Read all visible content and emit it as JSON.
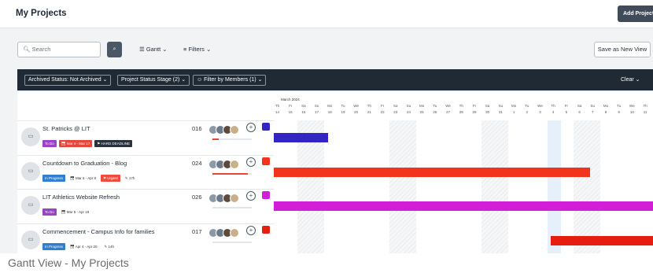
{
  "header": {
    "title": "My Projects",
    "add_button": "Add Project"
  },
  "toolbar": {
    "search_placeholder": "Search",
    "view_select": "Gantt",
    "filters_label": "Filters",
    "save_view": "Save as New View"
  },
  "filterbar": {
    "chips": [
      "Archived Status: Not Archived",
      "Project Status Stage (2)",
      "Filter by Members (1)"
    ],
    "clear": "Clear"
  },
  "timeline": {
    "month": "March 2024",
    "weekdays": [
      "Th",
      "Fr",
      "Sa",
      "Su",
      "Mo",
      "Tu",
      "We",
      "Th",
      "Fr",
      "Sa",
      "Su",
      "Mo",
      "Tu",
      "We",
      "Th",
      "Fr",
      "Sa",
      "Su",
      "Mo",
      "Tu",
      "We",
      "Th",
      "Fr",
      "Sa",
      "Su",
      "Mo",
      "Tu",
      "We",
      "Th"
    ],
    "dates": [
      "14",
      "15",
      "16",
      "17",
      "18",
      "19",
      "20",
      "21",
      "22",
      "23",
      "24",
      "25",
      "26",
      "27",
      "28",
      "29",
      "30",
      "31",
      "1",
      "2",
      "3",
      "4",
      "5",
      "6",
      "7",
      "8",
      "9",
      "10",
      "11"
    ]
  },
  "projects": [
    {
      "name": "St. Patricks @ LIT",
      "id": "016",
      "status": "To Do",
      "date": "Mar 4 - Mar 17",
      "flag": "HARD DEADLINE",
      "avatar_icon": "folder-icon",
      "bar_color": "#3324c4",
      "progress": 0.15
    },
    {
      "name": "Countdown to Graduation - Blog",
      "id": "024",
      "status": "In Progress",
      "date": "Mar 5 - Apr 8",
      "flag": "Urgent",
      "hours": "17h",
      "avatar_icon": "user-photo",
      "bar_color": "#f2341d",
      "progress": 0.9
    },
    {
      "name": "LIT Athletics Website Refresh",
      "id": "026",
      "status": "To Do",
      "date": "Mar 5 - Apr 19",
      "avatar_icon": "mascot-logo",
      "bar_color": "#d21ed6",
      "progress": 0
    },
    {
      "name": "Commencement - Campus Info for families",
      "id": "017",
      "status": "In Progress",
      "date": "Apr 4 - Apr 20",
      "hours": "14h",
      "avatar_icon": "folder-icon",
      "bar_color": "#e61e10",
      "progress": 0
    }
  ],
  "caption": "Gantt View - My Projects"
}
